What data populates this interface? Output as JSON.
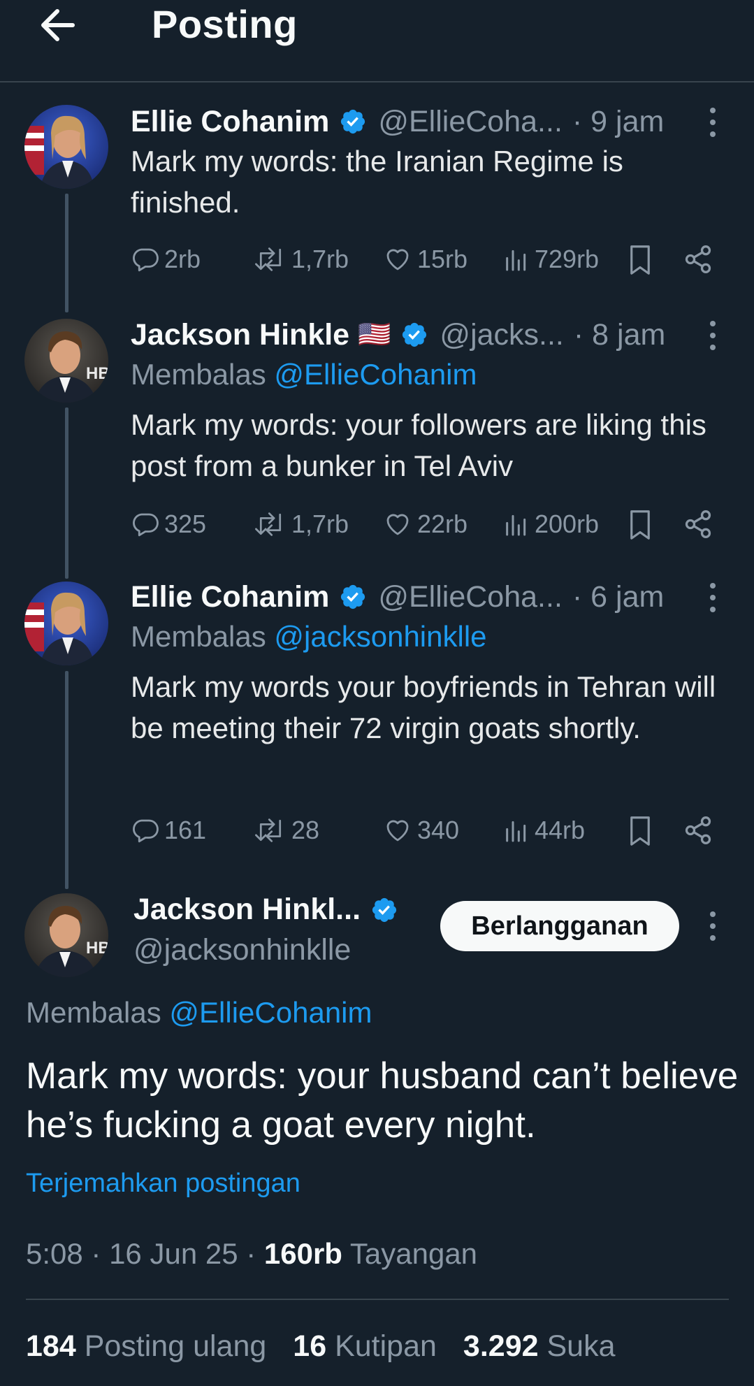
{
  "header": {
    "title": "Posting"
  },
  "posts": [
    {
      "name": "Ellie Cohanim",
      "handle": "@EllieCoha...",
      "time": "· 9 jam",
      "text": "Mark my words: the Iranian Regime is finished.",
      "counts": {
        "replies": "2rb",
        "reposts": "1,7rb",
        "likes": "15rb",
        "views": "729rb"
      }
    },
    {
      "name": "Jackson Hinkle",
      "flag": "🇺🇸",
      "handle": "@jacks...",
      "time": "· 8 jam",
      "reply_prefix": "Membalas ",
      "reply_to": "@EllieCohanim",
      "text": "Mark my words: your followers are liking this post from a bunker in Tel Aviv",
      "counts": {
        "replies": "325",
        "reposts": "1,7rb",
        "likes": "22rb",
        "views": "200rb"
      }
    },
    {
      "name": "Ellie Cohanim",
      "handle": "@EllieCoha...",
      "time": "· 6 jam",
      "reply_prefix": "Membalas ",
      "reply_to": "@jacksonhinklle",
      "text": "Mark my words your boyfriends in Tehran will be meeting their 72 virgin goats shortly.",
      "counts": {
        "replies": "161",
        "reposts": "28",
        "likes": "340",
        "views": "44rb"
      }
    }
  ],
  "main_post": {
    "name": "Jackson Hinkl...",
    "handle": "@jacksonhinklle",
    "subscribe_label": "Berlangganan",
    "reply_prefix": "Membalas ",
    "reply_to": "@EllieCohanim",
    "text": "Mark my words: your husband can’t believe he’s fucking a goat every night.",
    "translate_label": "Terjemahkan postingan",
    "time": "5:08 · 16 Jun 25 · ",
    "views_count": "160rb",
    "views_label": " Tayangan",
    "stats": [
      {
        "count": "184",
        "label": " Posting ulang"
      },
      {
        "count": "16",
        "label": " Kutipan"
      },
      {
        "count": "3.292",
        "label": " Suka"
      }
    ]
  },
  "colors": {
    "background": "#15202b",
    "accent": "#1d9bf0",
    "muted": "#8b98a5",
    "verified": "#1d9bf0"
  }
}
